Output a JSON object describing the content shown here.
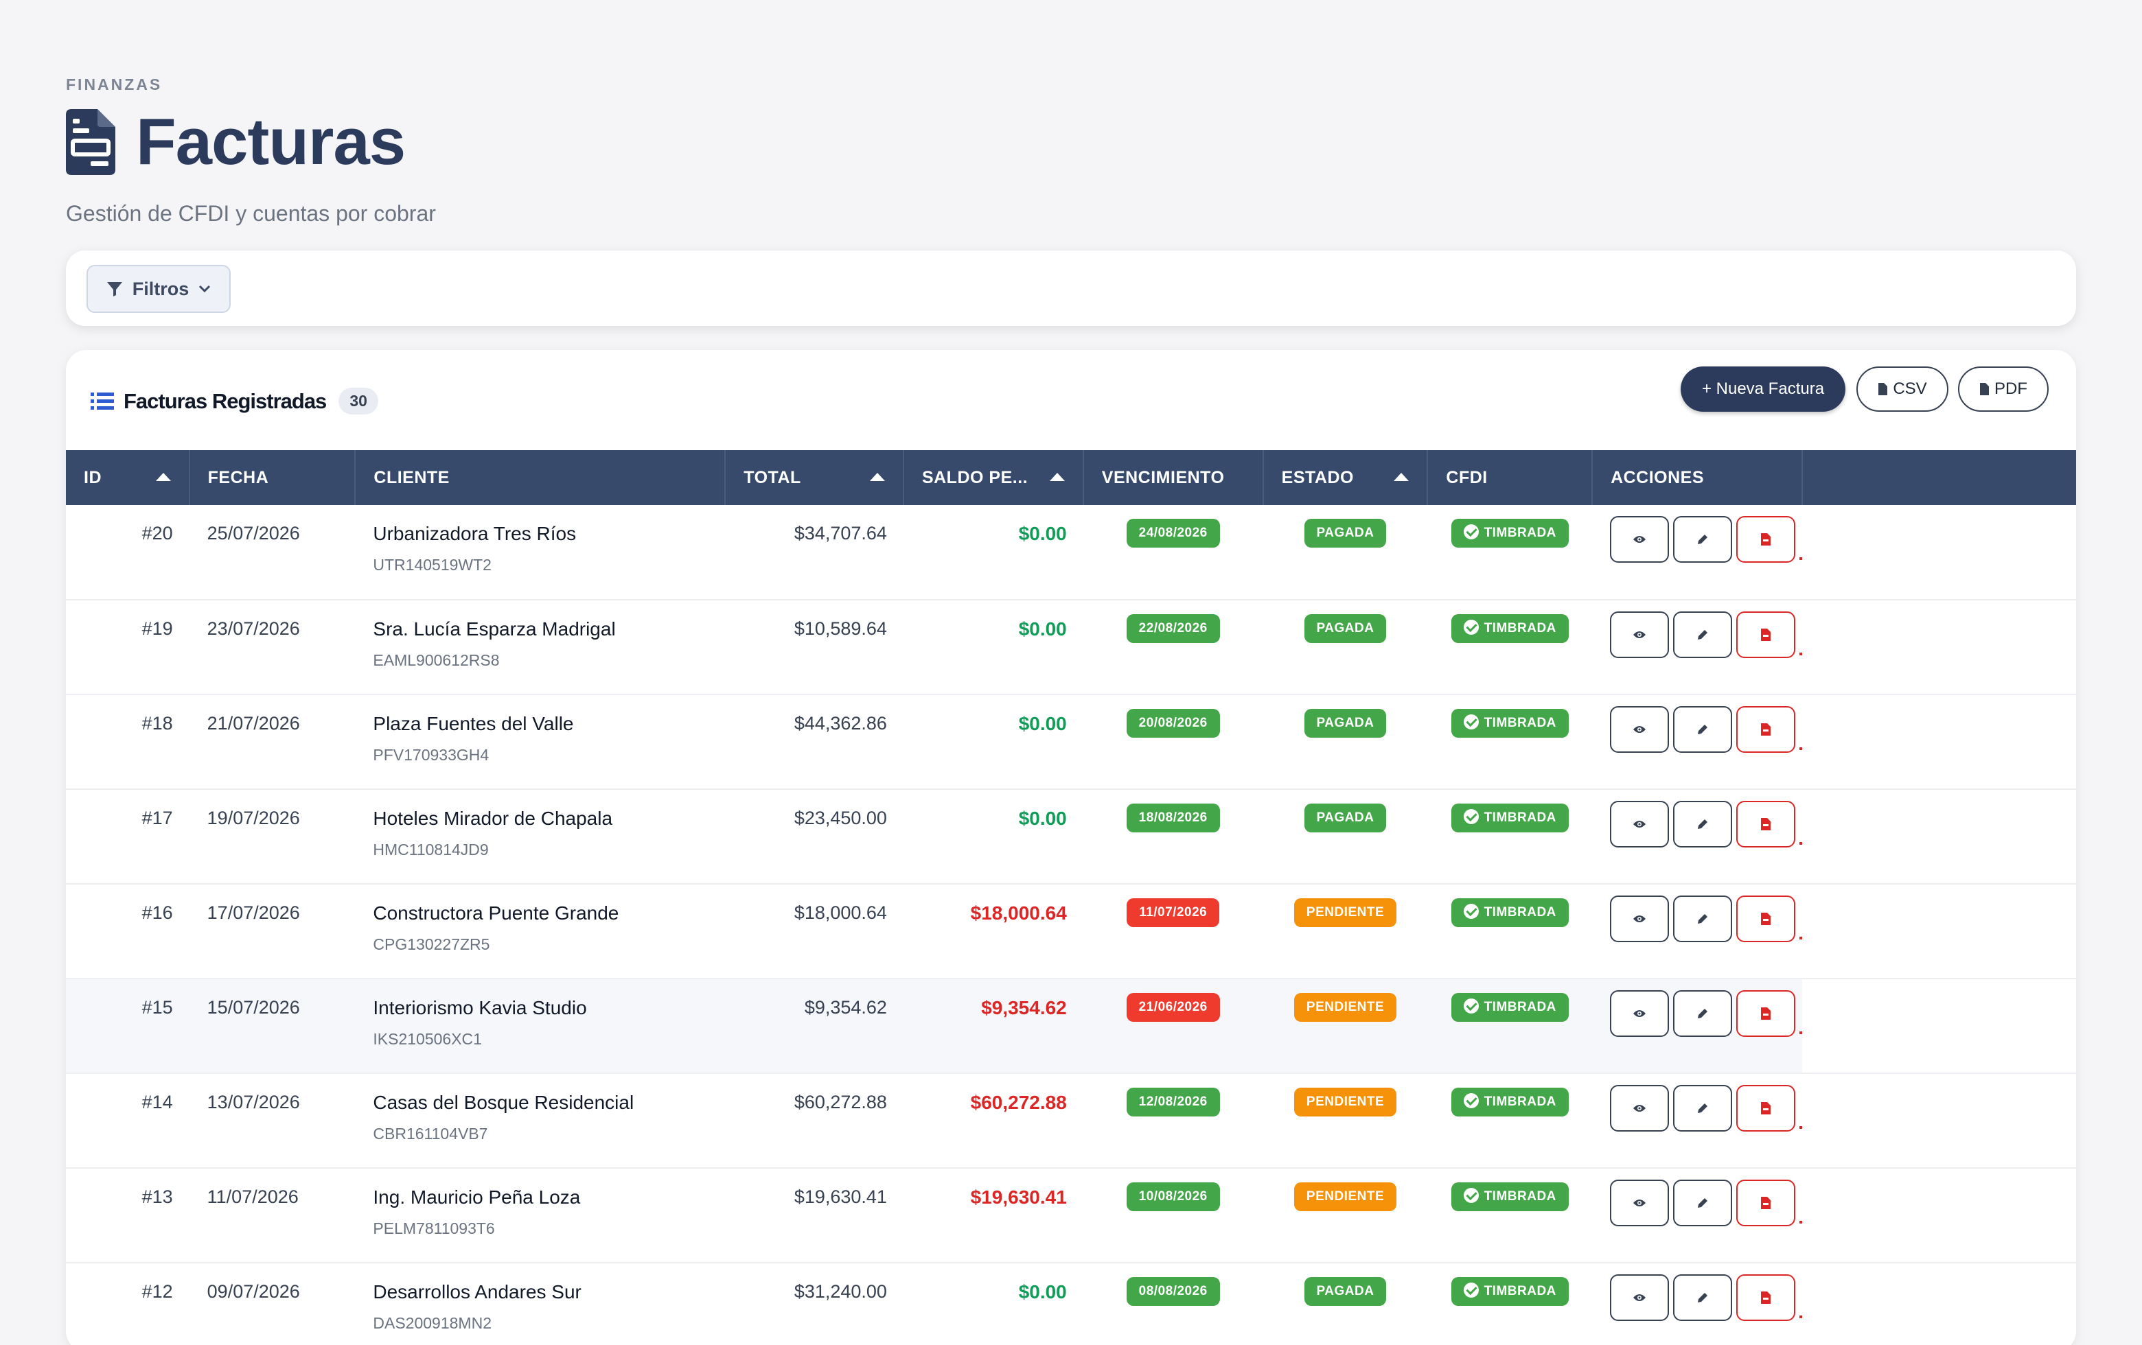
{
  "header": {
    "eyebrow": "FINANZAS",
    "title": "Facturas",
    "subtitle": "Gestión de CFDI y cuentas por cobrar"
  },
  "filters": {
    "label": "Filtros"
  },
  "card": {
    "title": "Facturas Registradas",
    "count": "30",
    "new_button": "+ Nueva Factura",
    "csv_button": "CSV",
    "pdf_button": "PDF"
  },
  "columns": [
    "ID",
    "FECHA",
    "CLIENTE",
    "TOTAL",
    "SALDO PE...",
    "VENCIMIENTO",
    "ESTADO",
    "CFDI",
    "ACCIONES"
  ],
  "rows": [
    {
      "id": "#20",
      "fecha": "25/07/2026",
      "cliente": "Urbanizadora Tres Ríos",
      "rfc": "UTR140519WT2",
      "total": "$34,707.64",
      "saldo": "$0.00",
      "saldo_status": "paid",
      "vencimiento": "24/08/2026",
      "venc_status": "ok",
      "estado": "PAGADA",
      "cfdi": "TIMBRADA"
    },
    {
      "id": "#19",
      "fecha": "23/07/2026",
      "cliente": "Sra. Lucía Esparza Madrigal",
      "rfc": "EAML900612RS8",
      "total": "$10,589.64",
      "saldo": "$0.00",
      "saldo_status": "paid",
      "vencimiento": "22/08/2026",
      "venc_status": "ok",
      "estado": "PAGADA",
      "cfdi": "TIMBRADA"
    },
    {
      "id": "#18",
      "fecha": "21/07/2026",
      "cliente": "Plaza Fuentes del Valle",
      "rfc": "PFV170933GH4",
      "total": "$44,362.86",
      "saldo": "$0.00",
      "saldo_status": "paid",
      "vencimiento": "20/08/2026",
      "venc_status": "ok",
      "estado": "PAGADA",
      "cfdi": "TIMBRADA"
    },
    {
      "id": "#17",
      "fecha": "19/07/2026",
      "cliente": "Hoteles Mirador de Chapala",
      "rfc": "HMC110814JD9",
      "total": "$23,450.00",
      "saldo": "$0.00",
      "saldo_status": "paid",
      "vencimiento": "18/08/2026",
      "venc_status": "ok",
      "estado": "PAGADA",
      "cfdi": "TIMBRADA"
    },
    {
      "id": "#16",
      "fecha": "17/07/2026",
      "cliente": "Constructora Puente Grande",
      "rfc": "CPG130227ZR5",
      "total": "$18,000.64",
      "saldo": "$18,000.64",
      "saldo_status": "due",
      "vencimiento": "11/07/2026",
      "venc_status": "overdue",
      "estado": "PENDIENTE",
      "cfdi": "TIMBRADA"
    },
    {
      "id": "#15",
      "fecha": "15/07/2026",
      "cliente": "Interiorismo Kavia Studio",
      "rfc": "IKS210506XC1",
      "total": "$9,354.62",
      "saldo": "$9,354.62",
      "saldo_status": "due",
      "vencimiento": "21/06/2026",
      "venc_status": "overdue",
      "estado": "PENDIENTE",
      "cfdi": "TIMBRADA",
      "highlight": true
    },
    {
      "id": "#14",
      "fecha": "13/07/2026",
      "cliente": "Casas del Bosque Residencial",
      "rfc": "CBR161104VB7",
      "total": "$60,272.88",
      "saldo": "$60,272.88",
      "saldo_status": "due",
      "vencimiento": "12/08/2026",
      "venc_status": "ok",
      "estado": "PENDIENTE",
      "cfdi": "TIMBRADA"
    },
    {
      "id": "#13",
      "fecha": "11/07/2026",
      "cliente": "Ing. Mauricio Peña Loza",
      "rfc": "PELM7811093T6",
      "total": "$19,630.41",
      "saldo": "$19,630.41",
      "saldo_status": "due",
      "vencimiento": "10/08/2026",
      "venc_status": "ok",
      "estado": "PENDIENTE",
      "cfdi": "TIMBRADA"
    },
    {
      "id": "#12",
      "fecha": "09/07/2026",
      "cliente": "Desarrollos Andares Sur",
      "rfc": "DAS200918MN2",
      "total": "$31,240.00",
      "saldo": "$0.00",
      "saldo_status": "paid",
      "vencimiento": "08/08/2026",
      "venc_status": "ok",
      "estado": "PAGADA",
      "cfdi": "TIMBRADA"
    }
  ],
  "colors": {
    "primary": "#2c3b5b",
    "table_header": "#374a6b",
    "badge_green": "#43a648",
    "badge_red": "#ef3b2d",
    "badge_orange": "#f5920a",
    "text_paid": "#0f9d58",
    "text_due": "#dc2626"
  },
  "icons": {
    "title": "invoice-document-icon",
    "filter": "funnel-icon",
    "dropdown": "chevron-down-icon",
    "list": "list-icon",
    "view": "eye-icon",
    "edit": "pencil-icon",
    "pdf": "pdf-file-icon"
  }
}
